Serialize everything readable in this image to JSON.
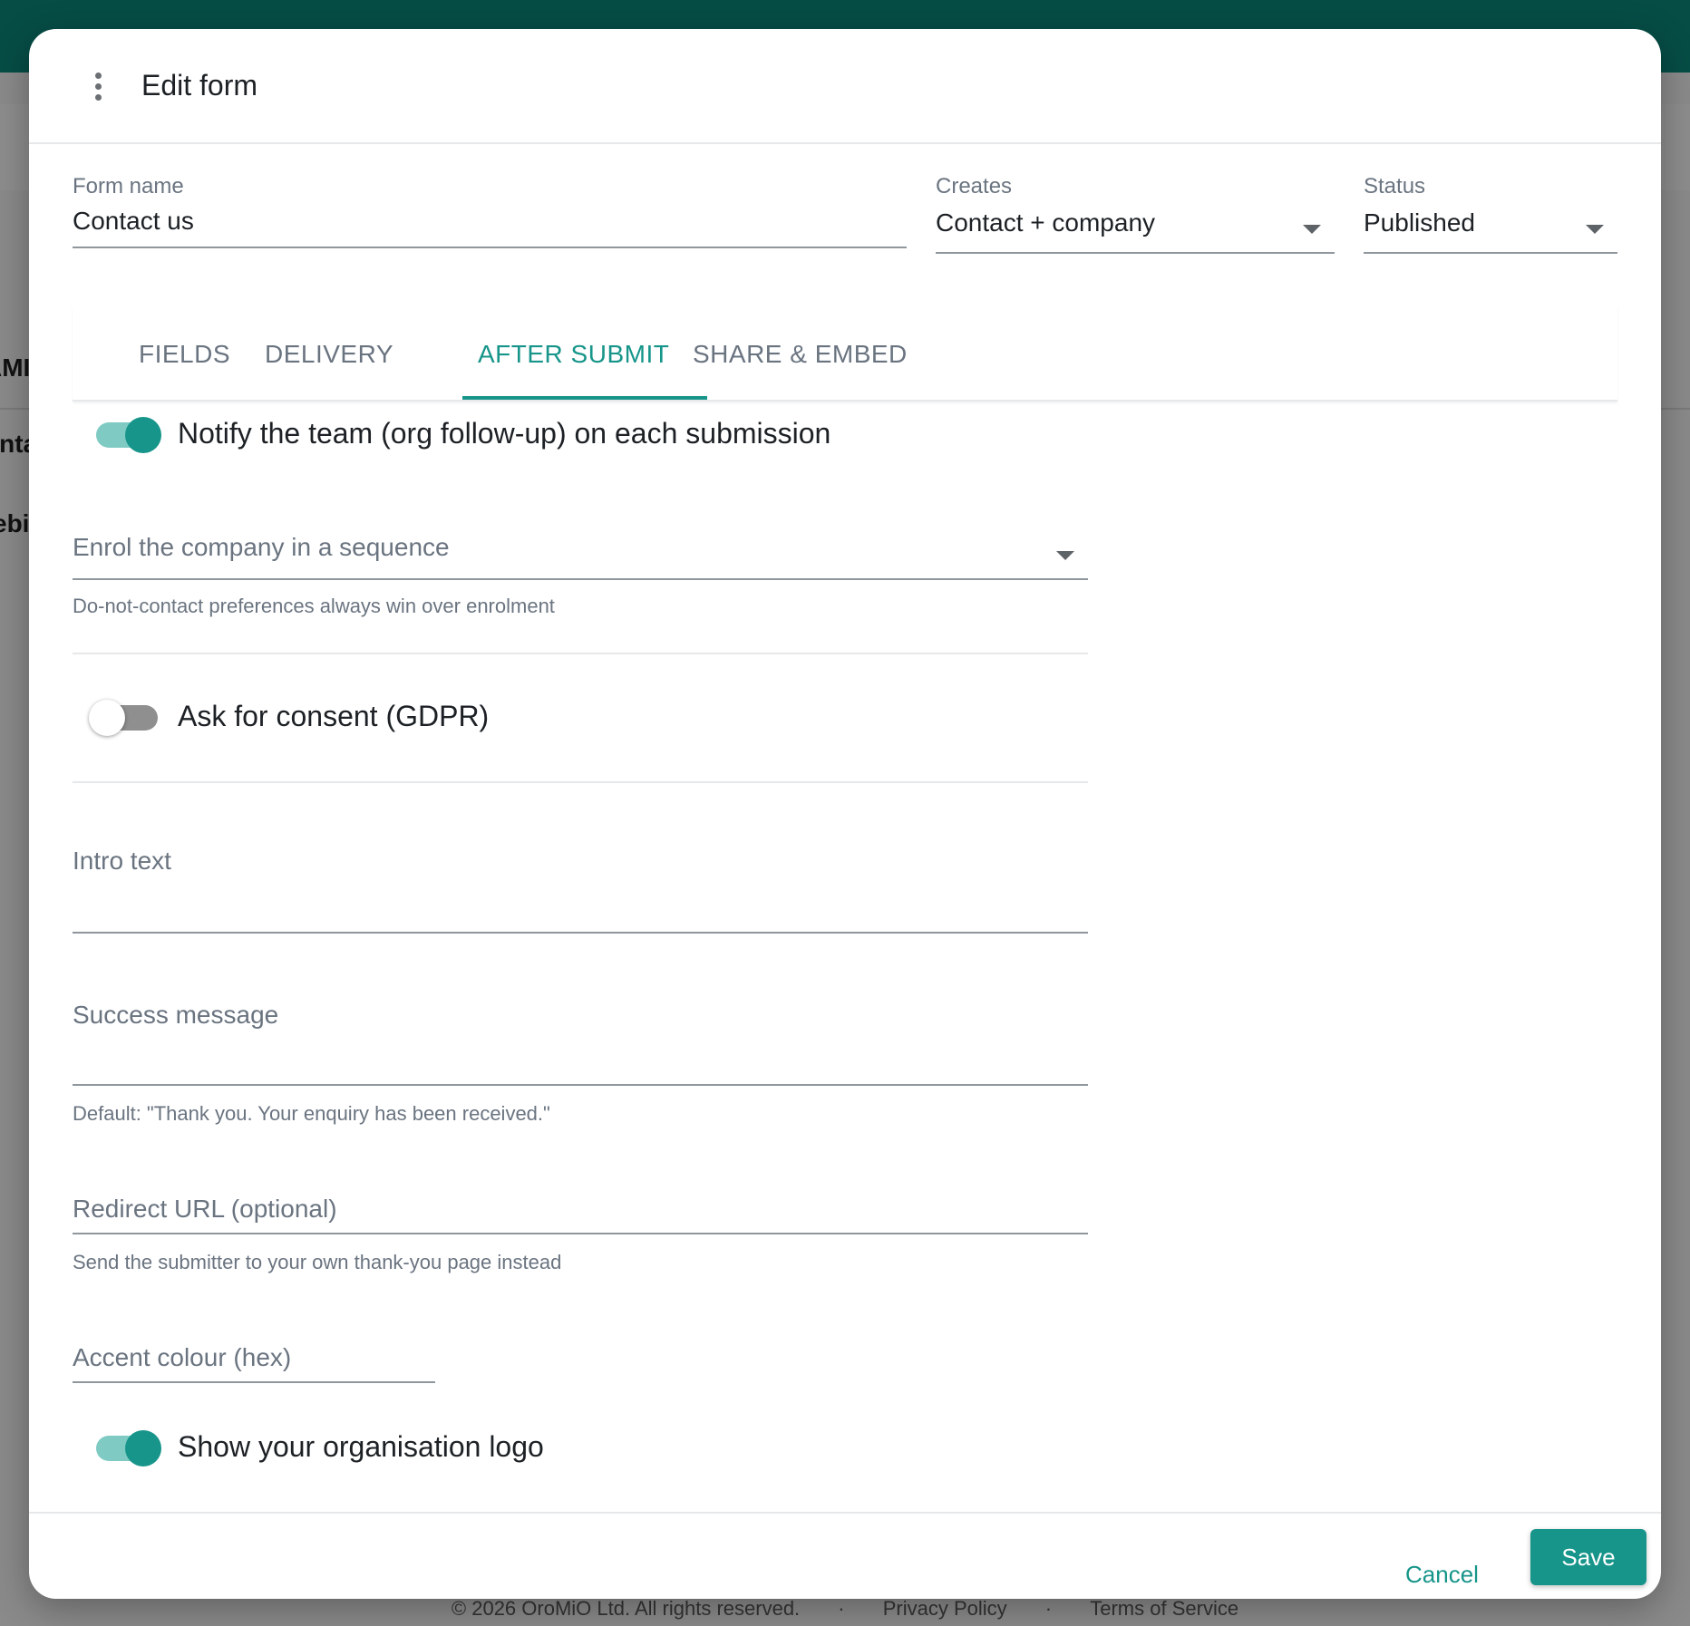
{
  "modal": {
    "title": "Edit form",
    "menu_icon": "more-vertical-icon"
  },
  "form": {
    "name_label": "Form name",
    "name_value": "Contact us",
    "creates_label": "Creates",
    "creates_value": "Contact + company",
    "status_label": "Status",
    "status_value": "Published"
  },
  "tabs": [
    {
      "label": "FIELDS",
      "active": false
    },
    {
      "label": "DELIVERY",
      "active": false
    },
    {
      "label": "AFTER SUBMIT",
      "active": true
    },
    {
      "label": "SHARE & EMBED",
      "active": false
    }
  ],
  "after_submit": {
    "notify_label": "Notify the team (org follow-up) on each submission",
    "notify_on": true,
    "sequence_placeholder": "Enrol the company in a sequence",
    "sequence_helper": "Do-not-contact preferences always win over enrolment",
    "consent_label": "Ask for consent (GDPR)",
    "consent_on": false,
    "intro_placeholder": "Intro text",
    "success_placeholder": "Success message",
    "success_helper": "Default: \"Thank you. Your enquiry has been received.\"",
    "redirect_placeholder": "Redirect URL (optional)",
    "redirect_helper": "Send the submitter to your own thank-you page instead",
    "accent_placeholder": "Accent colour (hex)",
    "logo_label": "Show your organisation logo",
    "logo_on": true
  },
  "footer": {
    "cancel_label": "Cancel",
    "save_label": "Save"
  },
  "background": {
    "copyright": "© 2026 OroMiO Ltd. All rights reserved.",
    "separator": "·",
    "privacy": "Privacy Policy",
    "terms": "Terms of Service"
  },
  "colors": {
    "accent": "#17958a",
    "topbar": "#064d46"
  }
}
